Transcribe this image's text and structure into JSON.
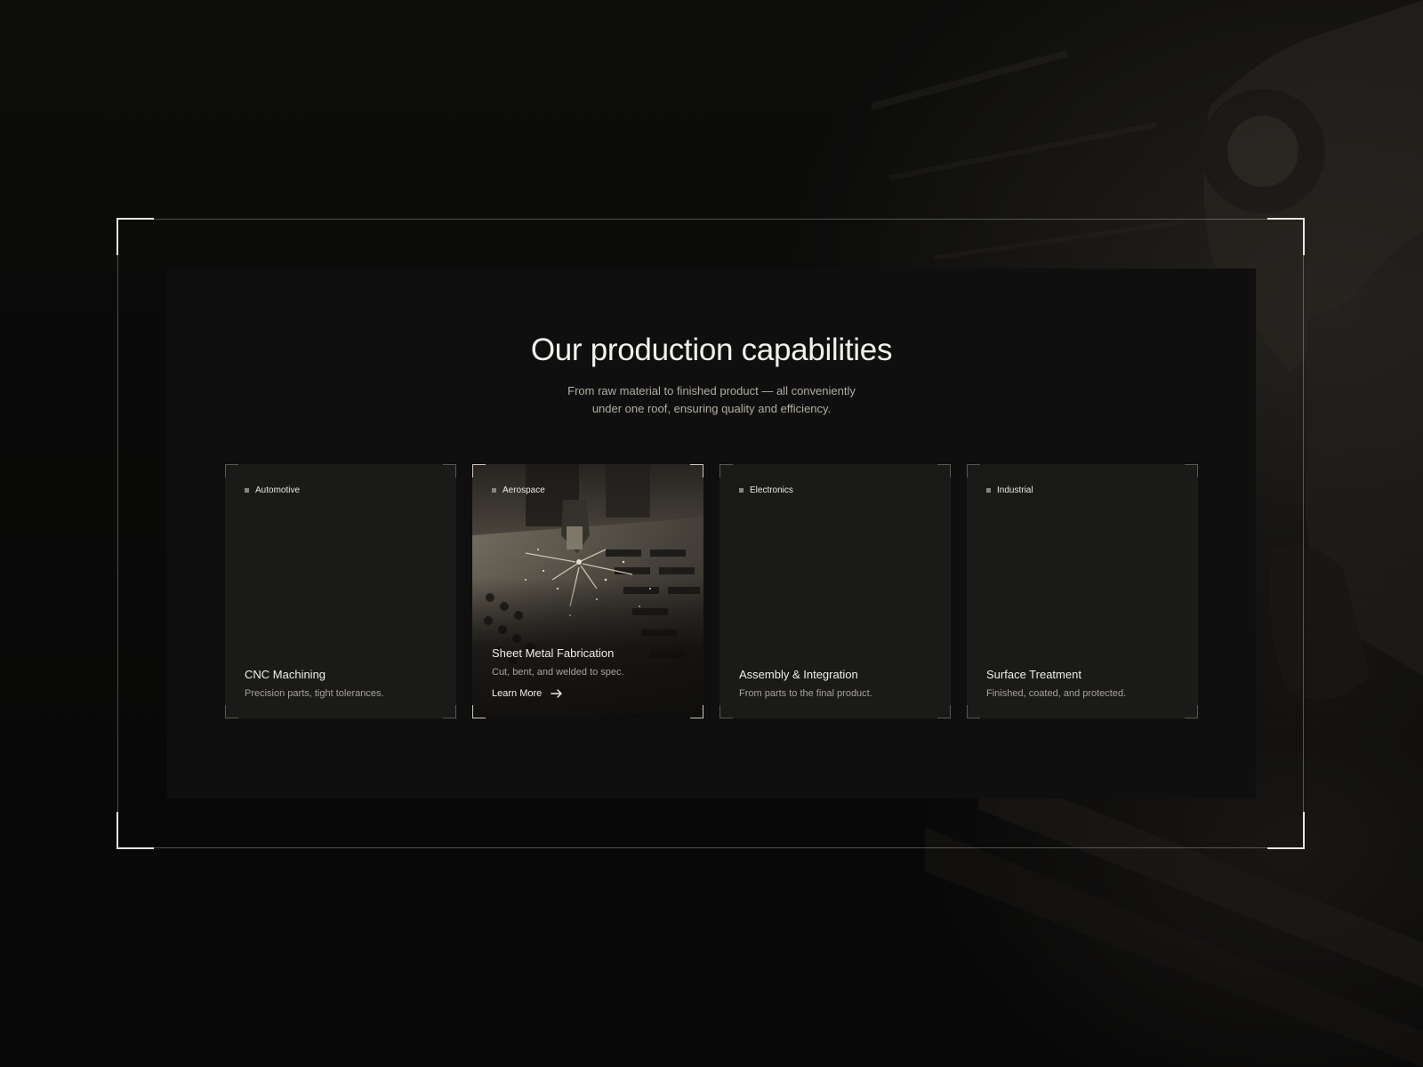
{
  "section": {
    "title": "Our production capabilities",
    "subtitle_line1": "From raw material to finished product — all conveniently",
    "subtitle_line2": "under one roof, ensuring quality and efficiency."
  },
  "cards": [
    {
      "tag": "Automotive",
      "title": "CNC Machining",
      "description": "Precision parts, tight tolerances."
    },
    {
      "tag": "Aerospace",
      "title": "Sheet Metal Fabrication",
      "description": "Cut, bent, and welded to spec.",
      "link_label": "Learn More",
      "active": true
    },
    {
      "tag": "Electronics",
      "title": "Assembly & Integration",
      "description": "From parts to the final product."
    },
    {
      "tag": "Industrial",
      "title": "Surface Treatment",
      "description": "Finished, coated, and protected."
    }
  ],
  "colors": {
    "background": "#080808",
    "panel": "#0f0f0f",
    "card": "#1a1a19",
    "text_primary": "#f1eee8",
    "text_secondary": "#a8a298",
    "accent_corner": "#e9e6e0"
  },
  "icons": {
    "link_arrow": "arrow-right-icon",
    "tag_marker": "square-bullet-icon"
  }
}
